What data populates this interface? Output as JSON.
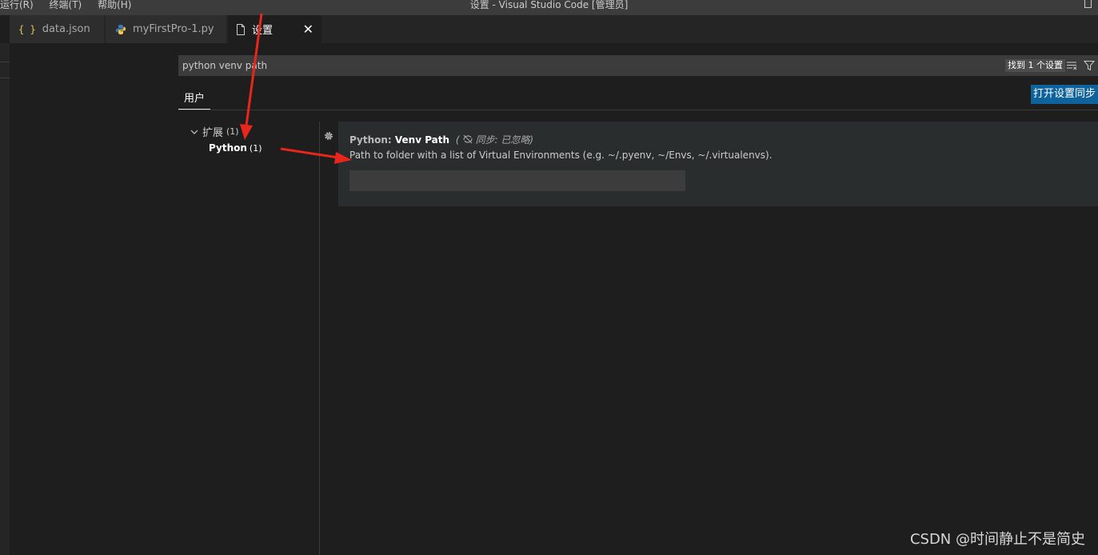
{
  "titlebar": {
    "menu_items": [
      "运行(R)",
      "终端(T)",
      "帮助(H)"
    ],
    "title": "设置 - Visual Studio Code [管理员]"
  },
  "tabs": [
    {
      "label": "data.json",
      "icon": "json-braces-icon"
    },
    {
      "label": "myFirstPro-1.py",
      "icon": "python-icon"
    },
    {
      "label": "设置",
      "icon": "file-icon",
      "active": true,
      "close": "✕"
    }
  ],
  "search": {
    "value": "python venv path",
    "result_count": "找到 1 个设置"
  },
  "scope_tab": "用户",
  "sync_button": "打开设置同步",
  "tree": {
    "group_label": "扩展",
    "group_count": "(1)",
    "item_label": "Python",
    "item_count": "(1)"
  },
  "setting": {
    "category": "Python: ",
    "name": "Venv Path",
    "sync_note": "同步: 已忽略)",
    "description": "Path to folder with a list of Virtual Environments (e.g. ~/.pyenv, ~/Envs, ~/.virtualenvs).",
    "value": ""
  },
  "watermark": "CSDN @时间静止不是简史",
  "colors": {
    "accent": "#0e639c",
    "annotation_arrow": "#e8261c",
    "json_icon": "#e8c35a"
  }
}
